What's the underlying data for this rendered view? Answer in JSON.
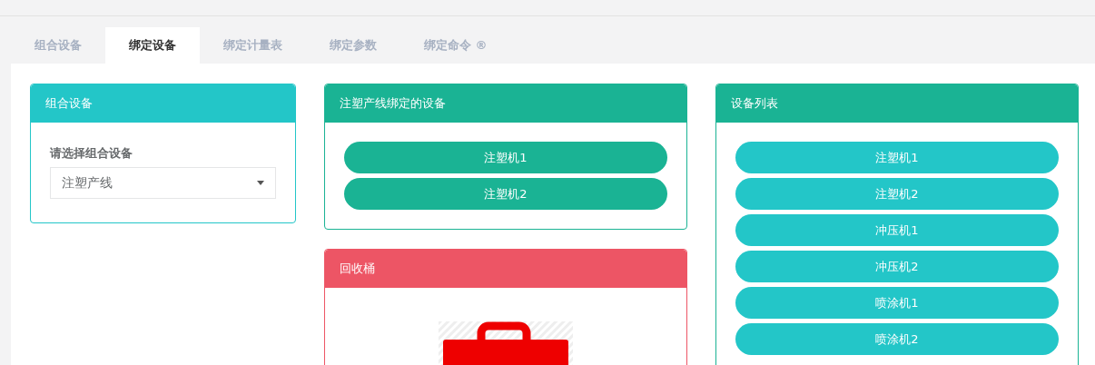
{
  "tabs": [
    {
      "label": "组合设备",
      "selected": false
    },
    {
      "label": "绑定设备",
      "selected": true
    },
    {
      "label": "绑定计量表",
      "selected": false
    },
    {
      "label": "绑定参数",
      "selected": false
    },
    {
      "label": "绑定命令 ®",
      "selected": false
    }
  ],
  "group_panel": {
    "title": "组合设备",
    "color": "#23c6c8",
    "field_label": "请选择组合设备",
    "select_value": "注塑产线"
  },
  "bound_panel": {
    "title": "注塑产线绑定的设备",
    "color": "#1ab394",
    "devices": [
      {
        "label": "注塑机1",
        "color": "#1ab394"
      },
      {
        "label": "注塑机2",
        "color": "#1ab394"
      }
    ]
  },
  "recycle_panel": {
    "title": "回收桶",
    "color": "#ed5565"
  },
  "list_panel": {
    "title": "设备列表",
    "color": "#1ab394",
    "devices": [
      {
        "label": "注塑机1",
        "color": "#23c6c8"
      },
      {
        "label": "注塑机2",
        "color": "#23c6c8"
      },
      {
        "label": "冲压机1",
        "color": "#23c6c8"
      },
      {
        "label": "冲压机2",
        "color": "#23c6c8"
      },
      {
        "label": "喷涂机1",
        "color": "#23c6c8"
      },
      {
        "label": "喷涂机2",
        "color": "#23c6c8"
      }
    ]
  }
}
